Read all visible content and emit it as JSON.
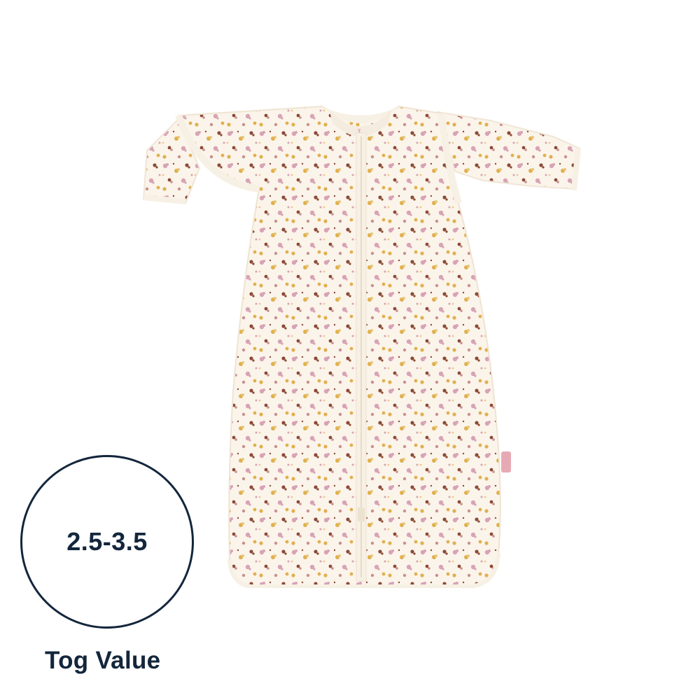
{
  "product": {
    "image_alt": "sleeping-bag-with-removable-sleeves",
    "fabric_color": "#fbf4ea",
    "pattern_colors": [
      "#d8a3b6",
      "#e0b04e",
      "#8c4a36",
      "#c98f8f",
      "#e7c87a"
    ],
    "trim_color": "#f7f0e4",
    "tag_color": "#e7aab4"
  },
  "tog": {
    "value": "2.5-3.5",
    "caption": "Tog Value",
    "color": "#13263c"
  }
}
